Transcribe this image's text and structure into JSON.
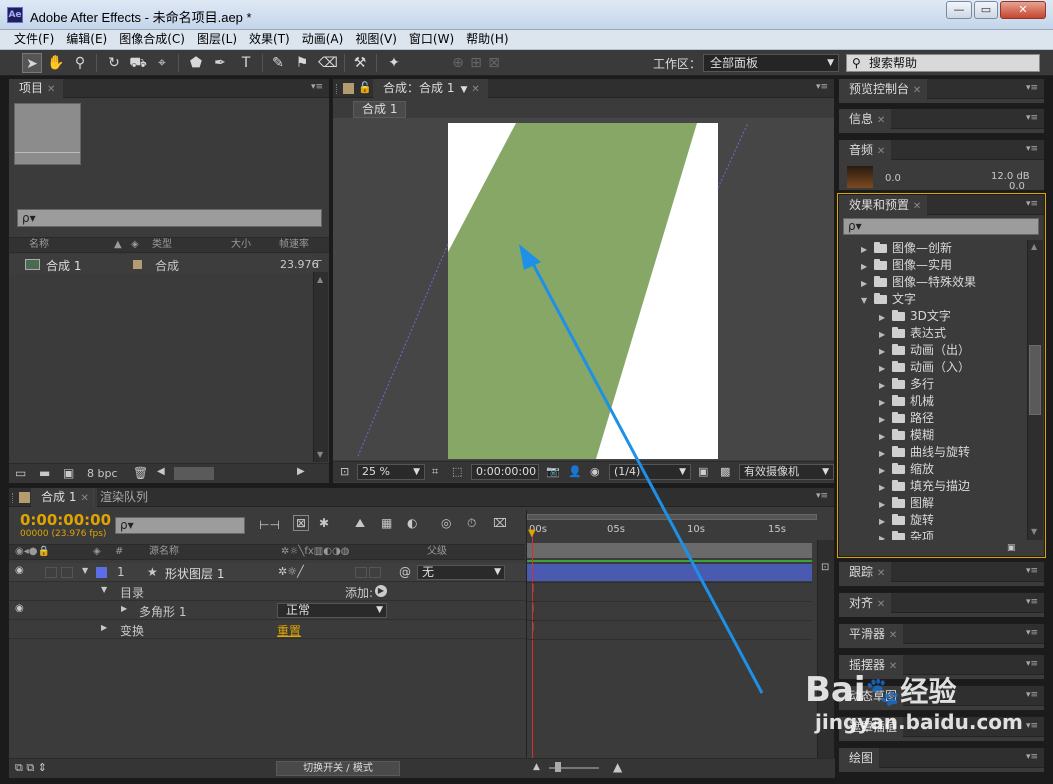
{
  "window": {
    "title": "Adobe After Effects - 未命名项目.aep *",
    "app_icon": "Ae",
    "min": "—",
    "max": "▭",
    "close": "✕"
  },
  "menu": [
    "文件(F)",
    "编辑(E)",
    "图像合成(C)",
    "图层(L)",
    "效果(T)",
    "动画(A)",
    "视图(V)",
    "窗口(W)",
    "帮助(H)"
  ],
  "toolbar": {
    "workspace_label": "工作区：",
    "workspace_value": "全部面板",
    "help_placeholder": "搜索帮助"
  },
  "project": {
    "tab": "项目",
    "search_placeholder": "ρ▾",
    "columns": {
      "name": "名称",
      "type": "类型",
      "size": "大小",
      "fps": "帧速率"
    },
    "item": {
      "name": "合成 1",
      "type": "合成",
      "fps": "23.976"
    },
    "footer_bpc": "8 bpc"
  },
  "composition": {
    "tab": "合成：合成 1",
    "subtab": "合成 1",
    "zoom": "25 %",
    "timecode": "0:00:00:00",
    "resolution": "(1/4)",
    "camera": "有效摄像机"
  },
  "timeline": {
    "tab": "合成 1",
    "tab2": "渲染队列",
    "timecode": "0:00:00:00",
    "fps_info": "00000 (23.976 fps)",
    "col_source": "源名称",
    "col_parent": "父级",
    "col_num": "#",
    "ruler": [
      "00s",
      "05s",
      "10s",
      "15s"
    ],
    "layer": {
      "num": "1",
      "name": "形状图层 1",
      "parent": "无"
    },
    "contents": "目录",
    "add_label": "添加:",
    "polygon": "多角形 1",
    "blend_mode": "正常",
    "transform": "变换",
    "reset": "重置",
    "footer_toggle": "切换开关 / 模式"
  },
  "right_panels": {
    "preview": "预览控制台",
    "info": "信息",
    "audio": "音频",
    "audio_left": "0.0",
    "audio_right": "12.0 dB",
    "audio_right2": "0.0",
    "effects": "效果和预置",
    "tree": [
      {
        "label": "图像—创新",
        "level": 1,
        "open": false
      },
      {
        "label": "图像—实用",
        "level": 1,
        "open": false
      },
      {
        "label": "图像—特殊效果",
        "level": 1,
        "open": false
      },
      {
        "label": "文字",
        "level": 1,
        "open": true
      },
      {
        "label": "3D文字",
        "level": 2,
        "open": false
      },
      {
        "label": "表达式",
        "level": 2,
        "open": false
      },
      {
        "label": "动画（出）",
        "level": 2,
        "open": false
      },
      {
        "label": "动画（入）",
        "level": 2,
        "open": false
      },
      {
        "label": "多行",
        "level": 2,
        "open": false
      },
      {
        "label": "机械",
        "level": 2,
        "open": false
      },
      {
        "label": "路径",
        "level": 2,
        "open": false
      },
      {
        "label": "模糊",
        "level": 2,
        "open": false
      },
      {
        "label": "曲线与旋转",
        "level": 2,
        "open": false
      },
      {
        "label": "缩放",
        "level": 2,
        "open": false
      },
      {
        "label": "填充与描边",
        "level": 2,
        "open": false
      },
      {
        "label": "图解",
        "level": 2,
        "open": false
      },
      {
        "label": "旋转",
        "level": 2,
        "open": false
      },
      {
        "label": "杂项",
        "level": 2,
        "open": false
      }
    ],
    "tracker": "跟踪",
    "align": "对齐",
    "smoother": "平滑器",
    "wiggler": "摇摆器",
    "motion_sketch": "动态草图",
    "mask_interp": "遮罩插值",
    "paint": "绘图"
  },
  "watermark": {
    "brand": "Bai",
    "brand_suffix": "经验",
    "url": "jingyan.baidu.com"
  },
  "colors": {
    "accent": "#e0a400",
    "layer_bar": "#4a5ab0",
    "shape_fill": "#87a766",
    "arrow": "#1e90e8",
    "label_blue": "#5b6ee6"
  }
}
